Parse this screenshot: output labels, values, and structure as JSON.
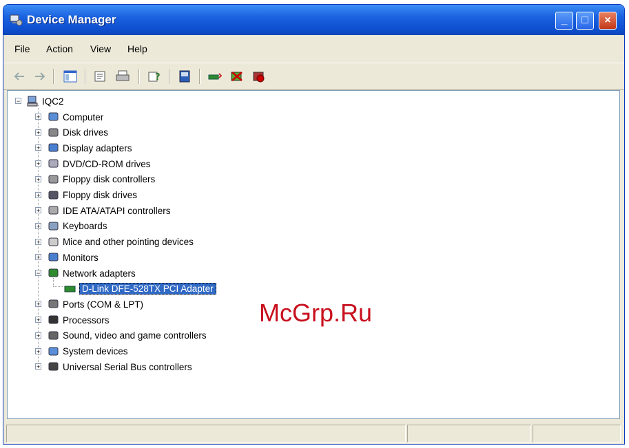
{
  "window": {
    "title": "Device Manager"
  },
  "menu": {
    "file": "File",
    "action": "Action",
    "view": "View",
    "help": "Help"
  },
  "toolbar": {
    "icons": [
      "back-arrow-icon",
      "forward-arrow-icon",
      "show-hide-tree-icon",
      "properties-icon",
      "print-icon",
      "help-icon",
      "scan-hardware-icon",
      "update-driver-icon",
      "uninstall-icon",
      "disable-icon"
    ]
  },
  "tree": {
    "root": "IQC2",
    "items": [
      {
        "label": "Computer",
        "icon": "computer-icon",
        "expanded": false
      },
      {
        "label": "Disk drives",
        "icon": "disk-drive-icon",
        "expanded": false
      },
      {
        "label": "Display adapters",
        "icon": "display-adapter-icon",
        "expanded": false
      },
      {
        "label": "DVD/CD-ROM drives",
        "icon": "cdrom-icon",
        "expanded": false
      },
      {
        "label": "Floppy disk controllers",
        "icon": "floppy-controller-icon",
        "expanded": false
      },
      {
        "label": "Floppy disk drives",
        "icon": "floppy-drive-icon",
        "expanded": false
      },
      {
        "label": "IDE ATA/ATAPI controllers",
        "icon": "ide-controller-icon",
        "expanded": false
      },
      {
        "label": "Keyboards",
        "icon": "keyboard-icon",
        "expanded": false
      },
      {
        "label": "Mice and other pointing devices",
        "icon": "mouse-icon",
        "expanded": false
      },
      {
        "label": "Monitors",
        "icon": "monitor-icon",
        "expanded": false
      },
      {
        "label": "Network adapters",
        "icon": "network-adapter-icon",
        "expanded": true
      },
      {
        "label": "Ports (COM & LPT)",
        "icon": "port-icon",
        "expanded": false
      },
      {
        "label": "Processors",
        "icon": "processor-icon",
        "expanded": false
      },
      {
        "label": "Sound, video and game controllers",
        "icon": "sound-icon",
        "expanded": false
      },
      {
        "label": "System devices",
        "icon": "system-device-icon",
        "expanded": false
      },
      {
        "label": "Universal Serial Bus controllers",
        "icon": "usb-icon",
        "expanded": false
      }
    ],
    "selected_child": "D-Link DFE-528TX PCI Adapter"
  },
  "watermark": "McGrp.Ru",
  "colors": {
    "titlebar": "#1a62e0",
    "selection": "#316ac5",
    "watermark": "#c8101e"
  }
}
